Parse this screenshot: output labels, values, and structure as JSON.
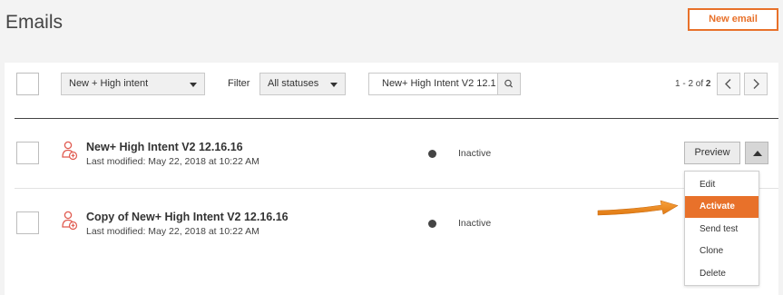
{
  "header": {
    "title": "Emails",
    "new_email_label": "New email"
  },
  "toolbar": {
    "segment_select": "New + High intent",
    "filter_label": "Filter",
    "status_select": "All statuses",
    "search_value": "New+ High Intent V2 12.1",
    "pagination_prefix": "1 - 2 of ",
    "pagination_total": "2"
  },
  "emails": [
    {
      "title": "New+ High Intent V2 12.16.16",
      "modified": "Last modified: May 22, 2018 at 10:22 AM",
      "status": "Inactive"
    },
    {
      "title": "Copy of New+ High Intent V2 12.16.16",
      "modified": "Last modified: May 22, 2018 at 10:22 AM",
      "status": "Inactive"
    }
  ],
  "row_actions": {
    "preview_label": "Preview"
  },
  "dropdown_menu": {
    "items": [
      "Edit",
      "Activate",
      "Send test",
      "Clone",
      "Delete"
    ],
    "active_index": 1
  },
  "colors": {
    "accent": "#e8712a",
    "icon_red": "#e05a4f",
    "status_dot": "#444444"
  },
  "icons": {
    "row_icon": "person-email-icon",
    "search": "search-icon",
    "prev": "chevron-left-icon",
    "next": "chevron-right-icon",
    "annotation": "orange-arrow-icon"
  }
}
